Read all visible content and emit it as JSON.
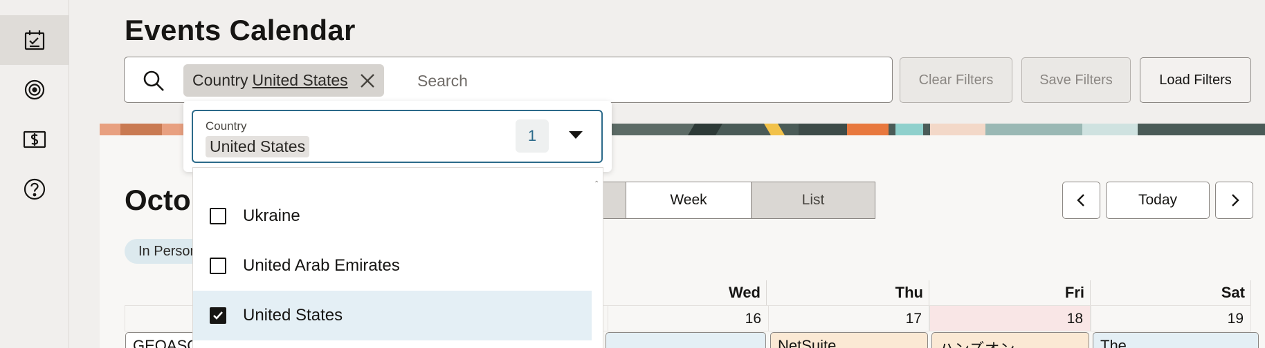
{
  "rail": {
    "items": [
      {
        "icon": "calendar-check-icon",
        "active": true
      },
      {
        "icon": "target-icon",
        "active": false
      },
      {
        "icon": "dollar-bill-icon",
        "active": false
      },
      {
        "icon": "help-icon",
        "active": false
      }
    ]
  },
  "header": {
    "title": "Events Calendar"
  },
  "search": {
    "chip_key": "Country",
    "chip_value": "United States",
    "placeholder": "Search"
  },
  "actions": {
    "clear_label": "Clear Filters",
    "save_label": "Save Filters",
    "load_label": "Load Filters"
  },
  "calendar": {
    "month_partial": "Octo",
    "views": [
      "Week",
      "List"
    ],
    "selected_view": "List",
    "today_label": "Today",
    "pill_partial": "In Person",
    "days": [
      {
        "name": "Wed",
        "num": "16"
      },
      {
        "name": "Thu",
        "num": "17"
      },
      {
        "name": "Fri",
        "num": "18",
        "highlight": true
      },
      {
        "name": "Sat",
        "num": "19"
      }
    ],
    "events": [
      {
        "text": "GEOASC",
        "color": "#ffffff"
      },
      {
        "text": "NetSuite",
        "color": "#fbe9d4"
      },
      {
        "text": "ハンズオン",
        "color": "#fbe9d4"
      },
      {
        "text": "The",
        "color": "#e4eff5"
      }
    ]
  },
  "country_filter": {
    "label": "Country",
    "selected_value": "United States",
    "count": "1",
    "options": [
      {
        "label": "Ukraine",
        "checked": false
      },
      {
        "label": "United Arab Emirates",
        "checked": false
      },
      {
        "label": "United States",
        "checked": true
      }
    ]
  },
  "colors": {
    "accent": "#2b6a8a",
    "background": "#f1efed",
    "selected_option_bg": "#e4eff5"
  }
}
